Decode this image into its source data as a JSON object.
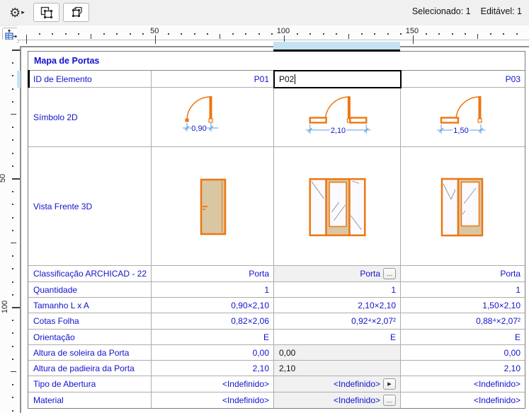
{
  "colors": {
    "text_blue": "#1212cc",
    "door_orange": "#ee7611",
    "door_tan": "#d9c7a3",
    "dim_blue": "#5b9fe0",
    "selection_highlight": "#c5e2f5"
  },
  "toolbar": {
    "settings_icon": "gear-icon",
    "flyout_arrow": "▸",
    "gear_glyph": "⚙"
  },
  "status": {
    "selected": "Selecionado: 1",
    "editable": "Editável: 1"
  },
  "rulers": {
    "horizontal_labels": [
      {
        "text": "50"
      },
      {
        "text": "100"
      },
      {
        "text": "150"
      }
    ],
    "vertical_labels": [
      {
        "text": "50"
      },
      {
        "text": "100"
      }
    ]
  },
  "controls": {
    "ellipsis_button": "…",
    "arrow_button": "▶"
  },
  "table": {
    "title": "Mapa de Portas",
    "rows": [
      {
        "label": "ID de Elemento",
        "p01": "P01",
        "p02": "P02",
        "p03": "P03"
      },
      {
        "label": "Símbolo 2D",
        "p01": "0,90",
        "p02": "2,10",
        "p03": "1,50"
      },
      {
        "label": "Vista Frente 3D"
      },
      {
        "label": "Classificação ARCHICAD - 22",
        "p01": "Porta",
        "p02": "Porta",
        "p03": "Porta"
      },
      {
        "label": "Quantidade",
        "p01": "1",
        "p02": "1",
        "p03": "1"
      },
      {
        "label": "Tamanho L x A",
        "p01": "0,90×2,10",
        "p02": "2,10×2,10",
        "p03": "1,50×2,10"
      },
      {
        "label": "Cotas Folha",
        "p01": "0,82×2,06",
        "p02": "0,92⁴×2,07²",
        "p03": "0,88⁴×2,07²"
      },
      {
        "label": "Orientação",
        "p01": "E",
        "p02": "E",
        "p03": "E"
      },
      {
        "label": "Altura de soleira da Porta",
        "p01": "0,00",
        "p02": "0,00",
        "p03": "0,00"
      },
      {
        "label": "Altura de padieira da Porta",
        "p01": "2,10",
        "p02": "2,10",
        "p03": "2,10"
      },
      {
        "label": "Tipo de Abertura",
        "p01": "<Indefinido>",
        "p02": "<Indefinido>",
        "p03": "<Indefinido>"
      },
      {
        "label": "Material",
        "p01": "<Indefinido>",
        "p02": "<Indefinido>",
        "p03": "<Indefinido>"
      }
    ]
  }
}
